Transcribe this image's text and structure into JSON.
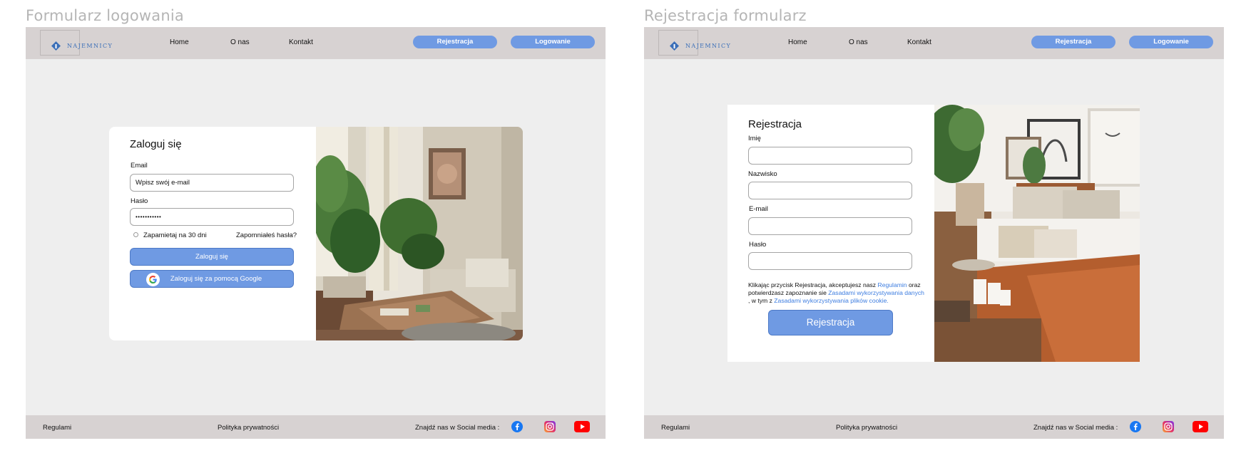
{
  "frames": {
    "login_title": "Formularz logowania",
    "register_title": "Rejestracja formularz"
  },
  "nav": {
    "logo_text": "NAJEMNICY",
    "links": [
      "Home",
      "O nas",
      "Kontakt"
    ],
    "register_button": "Rejestracja",
    "login_button": "Logowanie"
  },
  "footer": {
    "terms": "Regulami",
    "privacy": "Polityka prywatności",
    "social_label": "Znajdź nas w Social media :",
    "social_icons": [
      "facebook-icon",
      "instagram-icon",
      "youtube-icon"
    ]
  },
  "login": {
    "title": "Zaloguj się",
    "email_label": "Email",
    "email_placeholder": "Wpisz swój e-mail",
    "password_label": "Hasło",
    "password_value": "•••••••••••",
    "remember_label": "Zapamietaj na 30 dni",
    "forgot_link": "Zapomniałeś hasła?",
    "submit_button": "Zaloguj się",
    "google_button": "Zaloguj się za pomocą Google"
  },
  "register": {
    "title": "Rejestracja",
    "first_name_label": "Imię",
    "last_name_label": "Nazwisko",
    "email_label": "E-mail",
    "password_label": "Hasło",
    "terms_text_1": "Klikając przycisk Rejestracja, akceptujesz nasz ",
    "terms_link_1": "Regulamin",
    "terms_text_2": " oraz potwierdzasz zapoznanie sie ",
    "terms_link_2": "Zasadami wykorzystywania danych",
    "terms_text_3": " , w tym z ",
    "terms_link_3": "Zasadami wykorzystywania plików cookie.",
    "submit_button": "Rejestracja"
  },
  "colors": {
    "primary": "#6f9ae3",
    "navbar": "#d7d2d2",
    "background": "#eeeeee",
    "link": "#3d7de0"
  }
}
